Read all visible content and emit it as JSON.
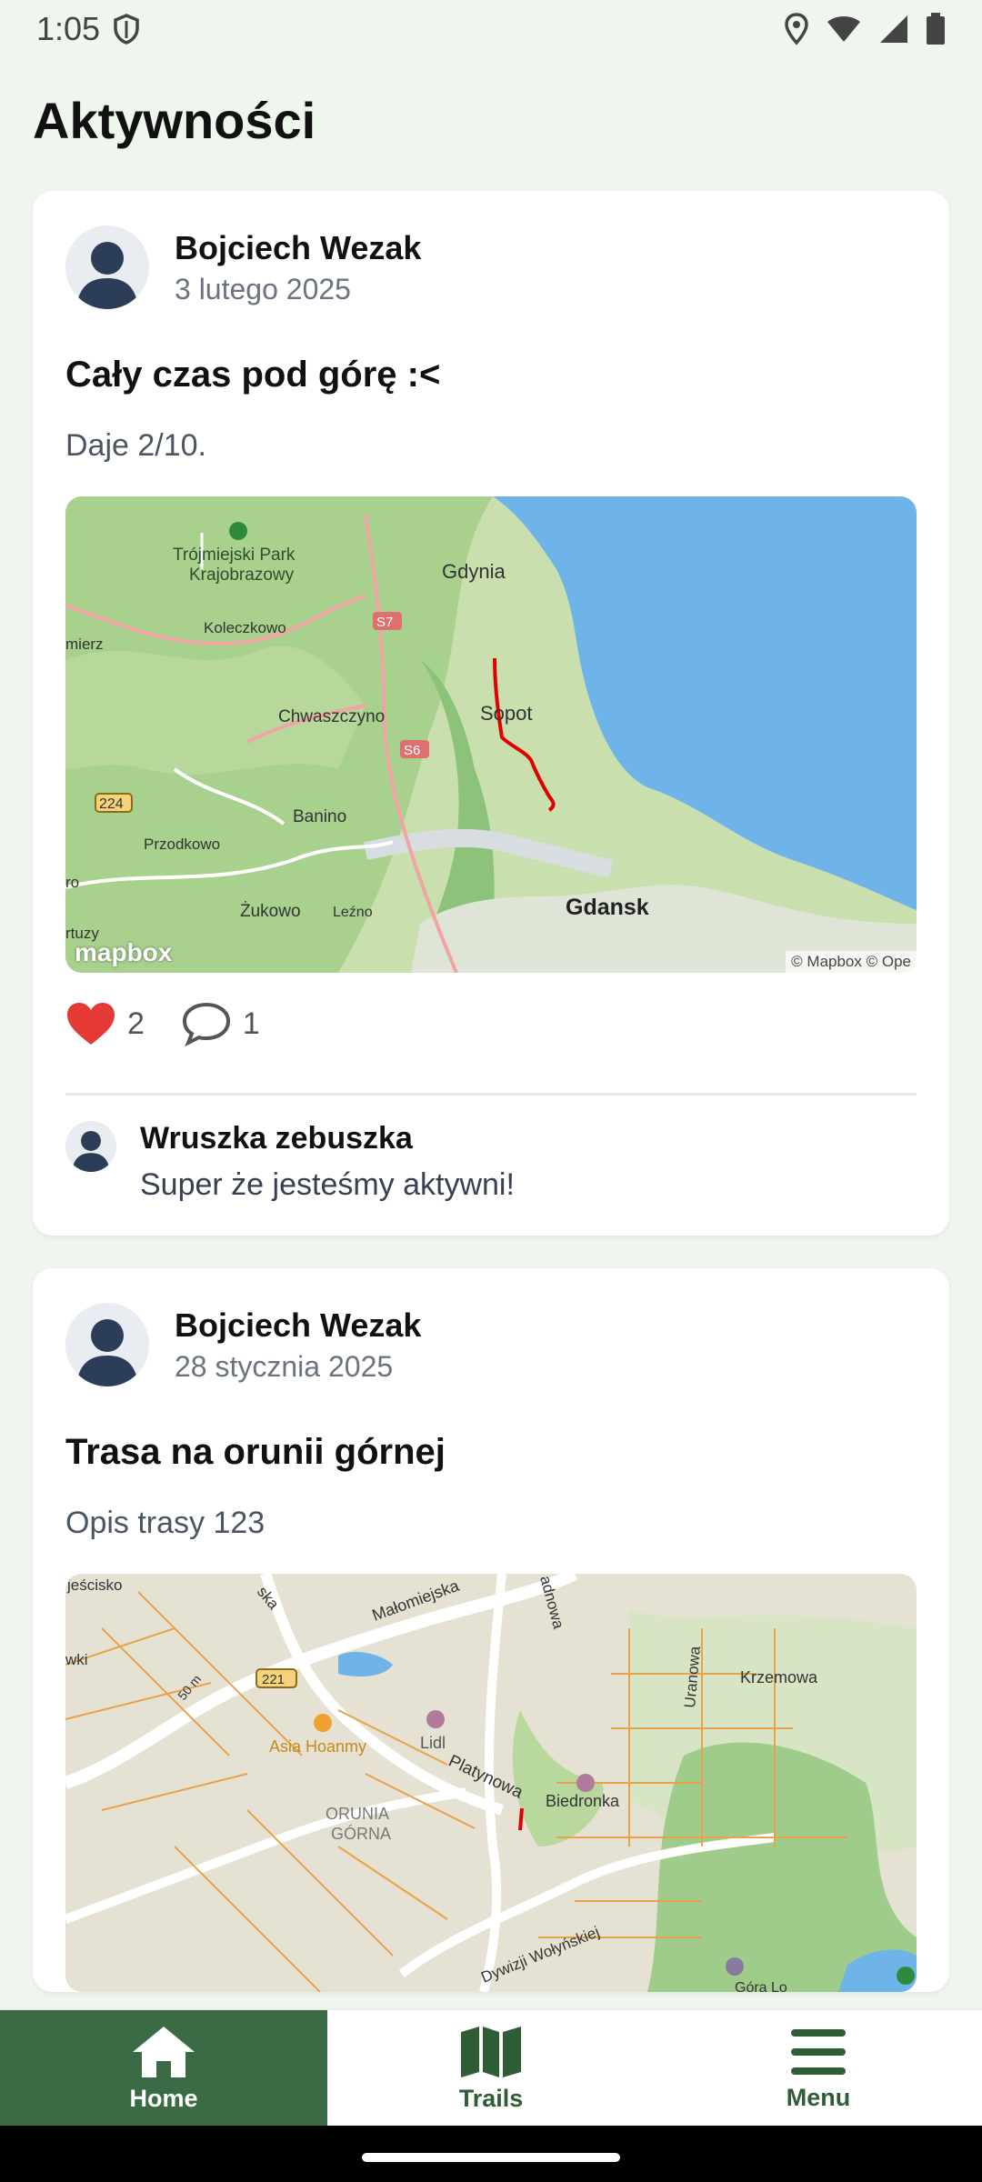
{
  "status": {
    "time": "1:05"
  },
  "page": {
    "title": "Aktywności"
  },
  "posts": [
    {
      "author": "Bojciech Wezak",
      "date": "3 lutego 2025",
      "title": "Cały czas pod górę :<",
      "description": "Daje 2/10.",
      "map": {
        "labels": {
          "park1": "Trójmiejski Park",
          "park2": "Krajobrazowy",
          "gdynia": "Gdynia",
          "koleczkowo": "Koleczkowo",
          "mierz": "mierz",
          "s7": "S7",
          "chwaszczyno": "Chwaszczyno",
          "sopot": "Sopot",
          "s6": "S6",
          "r224": "224",
          "banino": "Banino",
          "przodkowo": "Przodkowo",
          "zukowo": "Żukowo",
          "lezno": "Leźno",
          "gdansk": "Gdansk",
          "kartuzy": "rtuzy",
          "ro": "ro"
        },
        "logo": "mapbox",
        "attribution": "© Mapbox © Ope"
      },
      "likes": "2",
      "comments": "1",
      "comment": {
        "author": "Wruszka zebuszka",
        "text": "Super że jesteśmy aktywni!"
      }
    },
    {
      "author": "Bojciech Wezak",
      "date": "28 stycznia 2025",
      "title": "Trasa na orunii górnej",
      "description": "Opis trasy 123",
      "map": {
        "labels": {
          "jescisko": "jeścisko",
          "ska": "ska",
          "malomiejska": "Małomiejska",
          "adnowa": "adnowa",
          "uranowa": "Uranowa",
          "krzemowa": "Krzemowa",
          "wki": "wki",
          "r221": "221",
          "m50": "50 m",
          "asia": "Asia Hoanmy",
          "lidl": "Lidl",
          "platynowa": "Platynowa",
          "biedronka": "Biedronka",
          "orunia1": "ORUNIA",
          "orunia2": "GÓRNA",
          "wolynskiej": "Dywizji Wołyńskiej",
          "gora": "Góra Lo"
        }
      }
    }
  ],
  "nav": {
    "home": "Home",
    "trails": "Trails",
    "menu": "Menu"
  },
  "colors": {
    "accent": "#3a6b44",
    "like": "#e53935",
    "route": "#e00000",
    "water": "#6fb4e8",
    "forest": "#9fcc8b"
  }
}
